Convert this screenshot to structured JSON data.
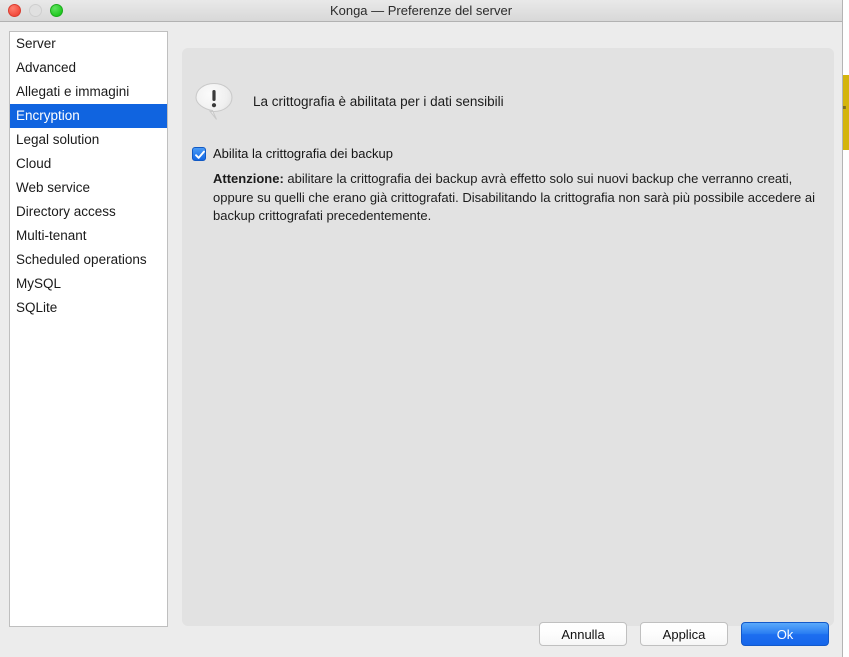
{
  "window": {
    "title": "Konga — Preferenze del server",
    "controls": {
      "close": "close-button",
      "minimize": "minimize-button",
      "zoom": "zoom-button"
    }
  },
  "background_window": {
    "visible_edge_text": "≡"
  },
  "sidebar": {
    "items": [
      {
        "label": "Server",
        "selected": false
      },
      {
        "label": "Advanced",
        "selected": false
      },
      {
        "label": "Allegati e immagini",
        "selected": false
      },
      {
        "label": "Encryption",
        "selected": true
      },
      {
        "label": "Legal solution",
        "selected": false
      },
      {
        "label": "Cloud",
        "selected": false
      },
      {
        "label": "Web service",
        "selected": false
      },
      {
        "label": "Directory access",
        "selected": false
      },
      {
        "label": "Multi-tenant",
        "selected": false
      },
      {
        "label": "Scheduled operations",
        "selected": false
      },
      {
        "label": "MySQL",
        "selected": false
      },
      {
        "label": "SQLite",
        "selected": false
      }
    ]
  },
  "main": {
    "info": {
      "icon": "exclamation-bubble-icon",
      "message": "La crittografia è abilitata per i dati sensibili"
    },
    "checkbox": {
      "label": "Abilita la crittografia dei backup",
      "checked": true
    },
    "warning": {
      "title": "Attenzione:",
      "body": " abilitare la crittografia dei backup avrà effetto solo sui nuovi backup che verranno creati, oppure su quelli che erano già crittografati. Disabilitando la crittografia non sarà più possibile accedere ai backup crittografati precedentemente."
    }
  },
  "footer": {
    "cancel_label": "Annulla",
    "apply_label": "Applica",
    "ok_label": "Ok"
  },
  "colors": {
    "selection_blue": "#1064e0",
    "primary_button_blue": "#1d6ef0",
    "panel_gray": "#e2e2e2",
    "window_gray": "#ececec",
    "background_window_yellow": "#d4b40c"
  }
}
